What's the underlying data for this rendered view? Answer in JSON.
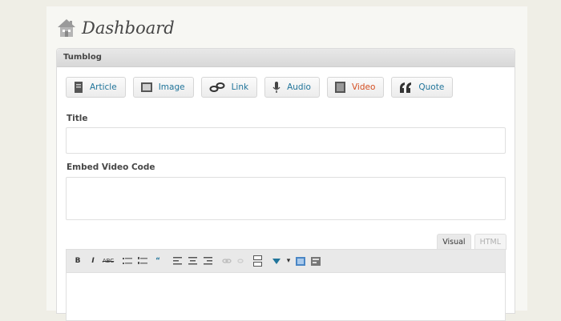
{
  "header": {
    "title": "Dashboard",
    "icon": "home-icon"
  },
  "panel": {
    "title": "Tumblog",
    "post_types": [
      {
        "label": "Article",
        "icon": "document-icon"
      },
      {
        "label": "Image",
        "icon": "image-icon"
      },
      {
        "label": "Link",
        "icon": "link-icon"
      },
      {
        "label": "Audio",
        "icon": "microphone-icon"
      },
      {
        "label": "Video",
        "icon": "video-icon"
      },
      {
        "label": "Quote",
        "icon": "quote-icon"
      }
    ],
    "title_label": "Title",
    "title_value": "",
    "embed_label": "Embed Video Code",
    "embed_value": "",
    "editor_tabs": [
      "Visual",
      "HTML"
    ],
    "toolbar": [
      "B",
      "I",
      "ABC",
      "bullets",
      "numbers",
      "quote",
      "align-left",
      "align-center",
      "align-right",
      "link",
      "unlink",
      "more",
      "spellcheck",
      "fullscreen",
      "kitchen-sink"
    ]
  },
  "colors": {
    "link": "#21759b",
    "active": "#d54e21",
    "panel_header": "#e0e0e0",
    "background": "#efeee6"
  }
}
